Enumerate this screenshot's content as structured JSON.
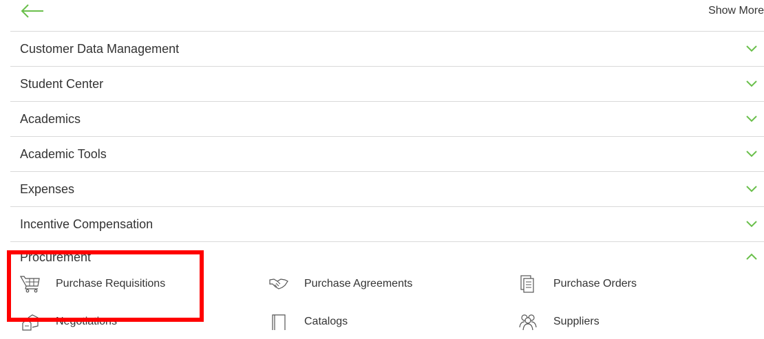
{
  "header": {
    "back_icon": "arrow-left-icon",
    "show_more_label": "Show More"
  },
  "colors": {
    "accent": "#6abf4b",
    "divider": "#d9d9d9",
    "highlight": "#ff0000"
  },
  "sections": [
    {
      "label": "Customer Data Management",
      "expanded": false
    },
    {
      "label": "Student Center",
      "expanded": false
    },
    {
      "label": "Academics",
      "expanded": false
    },
    {
      "label": "Academic Tools",
      "expanded": false
    },
    {
      "label": "Expenses",
      "expanded": false
    },
    {
      "label": "Incentive Compensation",
      "expanded": false
    }
  ],
  "procurement": {
    "label": "Procurement",
    "expanded": true,
    "items": [
      {
        "label": "Purchase Requisitions",
        "icon": "shopping-cart-icon"
      },
      {
        "label": "Purchase Agreements",
        "icon": "handshake-icon"
      },
      {
        "label": "Purchase Orders",
        "icon": "document-icon"
      },
      {
        "label": "Negotiations",
        "icon": "negotiation-icon"
      },
      {
        "label": "Catalogs",
        "icon": "catalog-icon"
      },
      {
        "label": "Suppliers",
        "icon": "suppliers-icon"
      }
    ]
  }
}
